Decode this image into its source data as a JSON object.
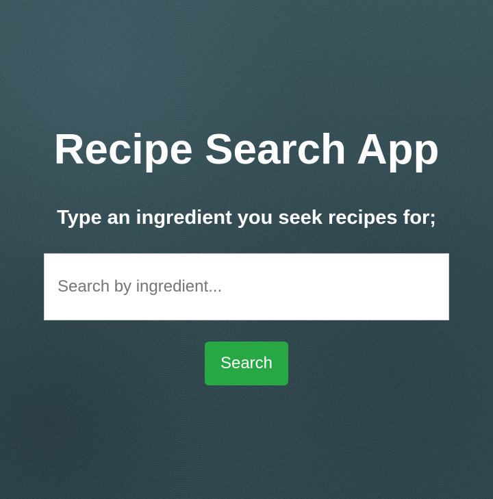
{
  "app": {
    "title": "Recipe Search App",
    "subtitle": "Type an ingredient you seek recipes for;"
  },
  "search": {
    "placeholder": "Search by ingredient...",
    "value": "",
    "button_label": "Search"
  },
  "colors": {
    "background": "#213a42",
    "text": "#ffffff",
    "button": "#28a745",
    "input_background": "#ffffff",
    "placeholder": "#757575"
  }
}
